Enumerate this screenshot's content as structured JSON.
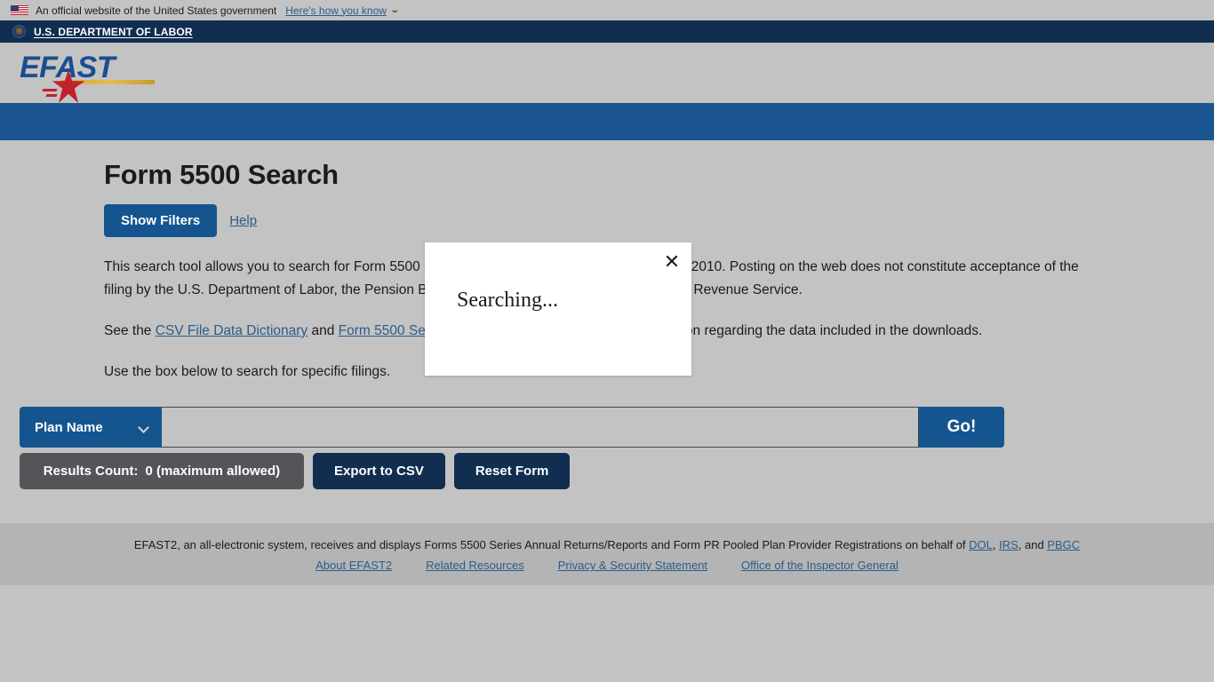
{
  "usa_banner": {
    "text": "An official website of the United States government",
    "link_label": "Here's how you know",
    "caret": "⌄",
    "flag_icon": "us-flag-icon"
  },
  "dol_bar": {
    "title": "U.S. DEPARTMENT OF LABOR",
    "seal_icon": "dol-seal-icon"
  },
  "logo": {
    "text": "EFAST",
    "star_icon": "red-star-icon",
    "swoosh_icon": "gold-swoosh-icon"
  },
  "page": {
    "title": "Form 5500 Search",
    "show_filters_label": "Show Filters",
    "help_label": "Help",
    "paragraph1_a": "This search tool allows you to search for Form 5500 series returns/reports filed since January 1, 2010. Posting on the web does not constitute acceptance of the filing by the U.S. Department of Labor, the Pension Benefit Guaranty Corporation, or the Internal Revenue Service.",
    "paragraph2_pre": "See the ",
    "paragraph2_link1": "CSV File Data Dictionary",
    "paragraph2_mid": " and ",
    "paragraph2_link2": "Form 5500 Series Data Dictionary",
    "paragraph2_post": " for additional information regarding the data included in the downloads.",
    "paragraph3": "Use the box below to search for specific filings."
  },
  "search_form": {
    "field_selector_value": "Plan Name",
    "field_selector_options": [
      "Plan Name"
    ],
    "chevron_icon": "chevron-down-icon",
    "query_value": "",
    "query_placeholder": "",
    "go_label": "Go!",
    "results_count_label": "Results Count:",
    "results_count_value": "0 (maximum allowed)",
    "export_label": "Export to CSV",
    "reset_label": "Reset Form"
  },
  "modal": {
    "message": "Searching...",
    "close_icon": "✕"
  },
  "footer": {
    "line1_pre": "EFAST2, an all-electronic system, receives and displays Forms 5500 Series Annual Returns/Reports and Form PR Pooled Plan Provider Registrations on behalf of ",
    "link_dol": "DOL",
    "sep1": ", ",
    "link_irs": "IRS",
    "sep2": ", and ",
    "link_pbgc": "PBGC",
    "links": [
      "About EFAST2",
      "Related Resources",
      "Privacy & Security Statement",
      "Office of the Inspector General"
    ]
  },
  "colors": {
    "page_background": "#c3c3c3",
    "nav_blue": "#1b5693",
    "dark_navy": "#112e51",
    "button_blue": "#14558f",
    "link_blue": "#2a5c8a",
    "results_gray": "#545559",
    "footer_gray": "#b4b4b4"
  }
}
